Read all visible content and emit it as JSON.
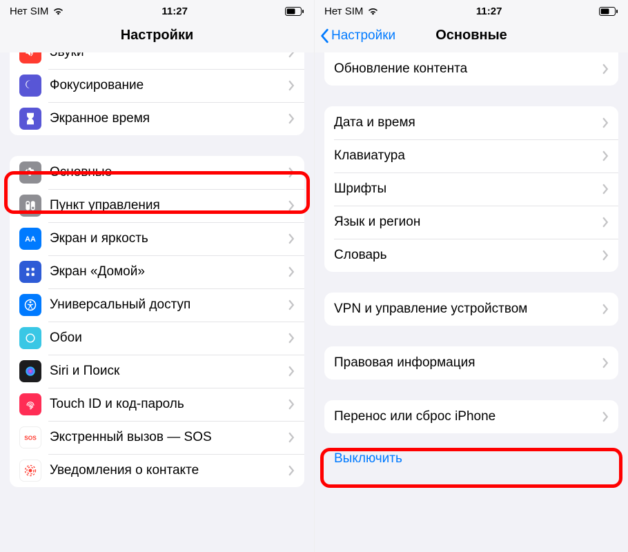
{
  "status": {
    "carrier": "Нет SIM",
    "time": "11:27"
  },
  "left": {
    "title": "Настройки",
    "rows": {
      "sounds": "Звуки",
      "focus": "Фокусирование",
      "screentime": "Экранное время",
      "general": "Основные",
      "control": "Пункт управления",
      "display": "Экран и яркость",
      "home": "Экран «Домой»",
      "accessibility": "Универсальный доступ",
      "wallpaper": "Обои",
      "siri": "Siri и Поиск",
      "touchid": "Touch ID и код-пароль",
      "sos": "Экстренный вызов — SOS",
      "exposure": "Уведомления о контакте"
    }
  },
  "right": {
    "back": "Настройки",
    "title": "Основные",
    "rows": {
      "background_refresh": "Обновление контента",
      "datetime": "Дата и время",
      "keyboard": "Клавиатура",
      "fonts": "Шрифты",
      "language": "Язык и регион",
      "dictionary": "Словарь",
      "vpn": "VPN и управление устройством",
      "legal": "Правовая информация",
      "transfer": "Перенос или сброс iPhone",
      "shutdown": "Выключить"
    }
  }
}
